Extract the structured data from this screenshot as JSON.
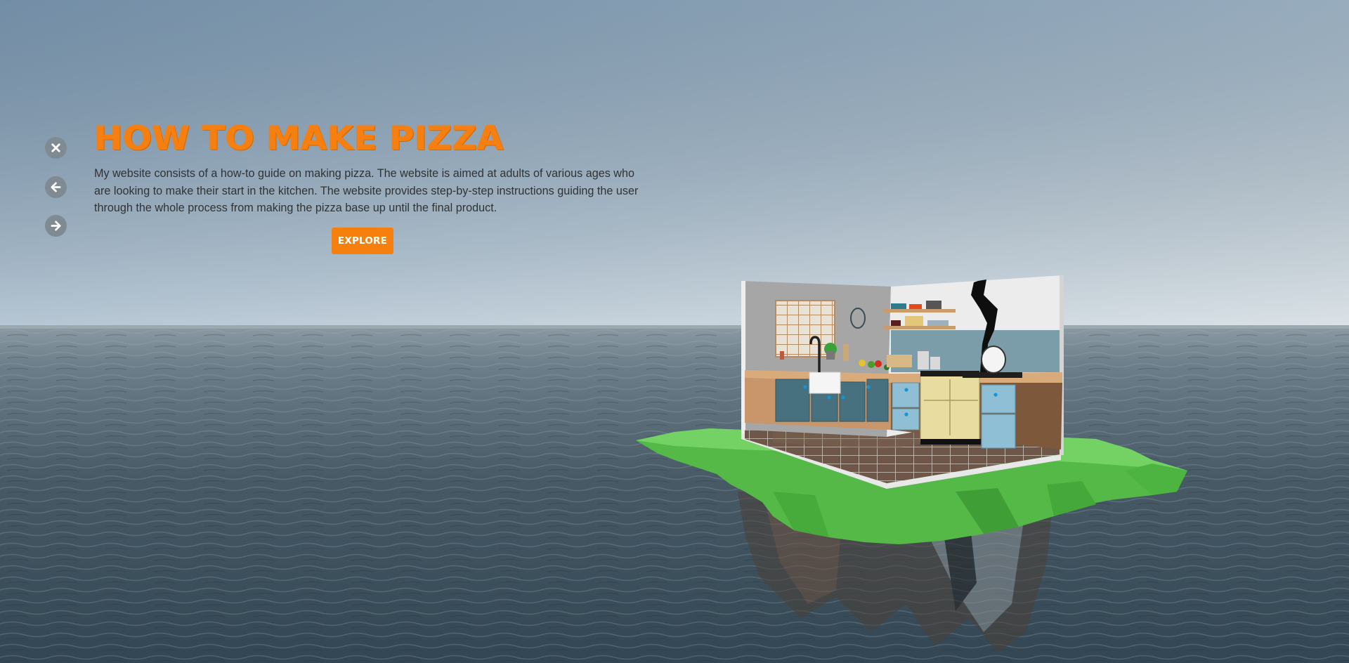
{
  "hero": {
    "title": "HOW TO MAKE PIZZA",
    "description": "My website consists of a how-to guide on making pizza. The website is aimed at adults of various ages who are looking to make their start in the kitchen. The website provides step-by-step instructions guiding the user through the whole process from making the pizza base up until the final product.",
    "explore_label": "EXPLORE"
  },
  "nav": {
    "close_icon": "close-icon",
    "prev_icon": "arrow-left-icon",
    "next_icon": "arrow-right-icon"
  },
  "colors": {
    "accent": "#f57f10",
    "sky_top": "#7e9ab3",
    "sky_bottom": "#c7d4dc",
    "ocean": "#3d4f5a",
    "island": "#5fc452"
  }
}
